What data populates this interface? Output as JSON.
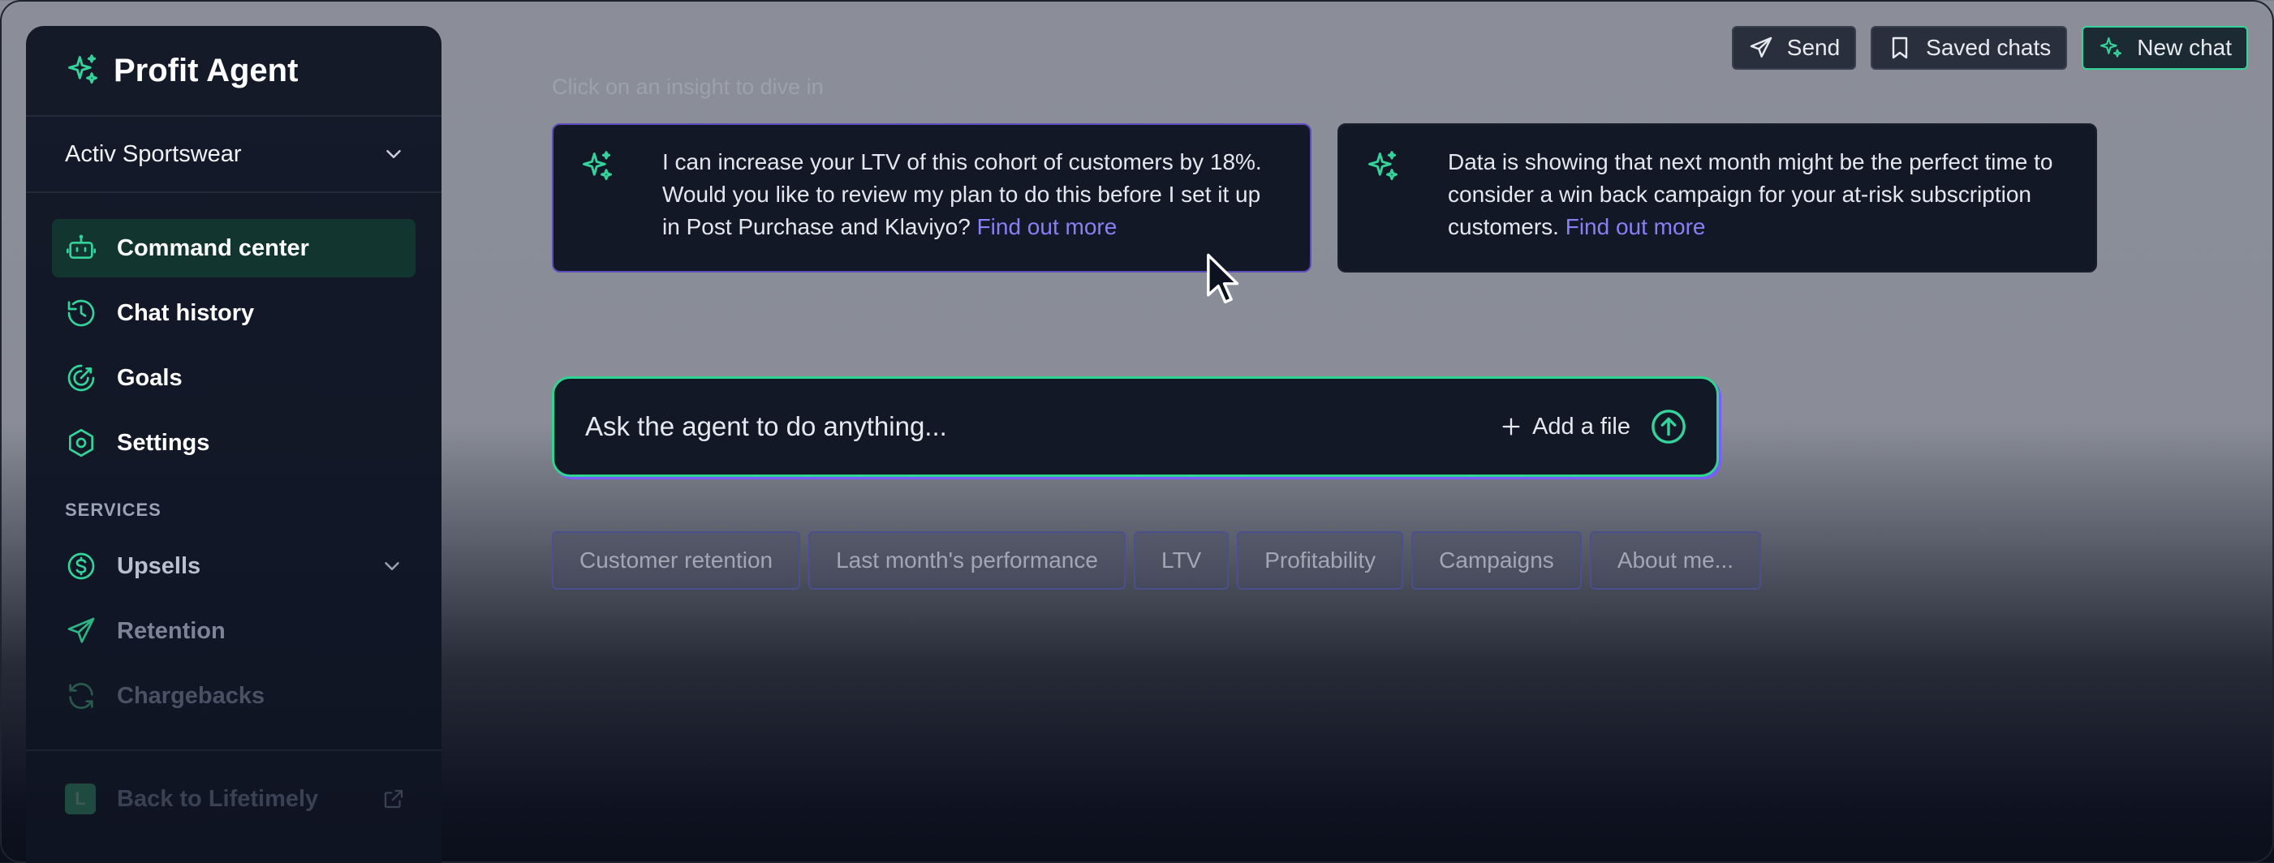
{
  "sidebar": {
    "brand_title": "Profit Agent",
    "store_selector": {
      "value": "Activ Sportswear"
    },
    "nav_items": [
      {
        "label": "Command center",
        "icon": "robot-icon",
        "active": true
      },
      {
        "label": "Chat history",
        "icon": "history-icon"
      },
      {
        "label": "Goals",
        "icon": "target-icon"
      },
      {
        "label": "Settings",
        "icon": "hexagon-settings-icon"
      }
    ],
    "services_title": "SERVICES",
    "services": [
      {
        "label": "Upsells",
        "icon": "dollar-circle-icon"
      },
      {
        "label": "Retention",
        "icon": "paper-plane-icon"
      },
      {
        "label": "Chargebacks",
        "icon": "refresh-icon"
      }
    ],
    "back_link": {
      "label": "Back to Lifetimely",
      "badge": "L"
    }
  },
  "top_actions": {
    "send": "Send",
    "saved_chats": "Saved chats",
    "new_chat": "New chat"
  },
  "main": {
    "hint": "Click on an insight to dive in",
    "insights": [
      {
        "text": "I can increase your LTV of this cohort of customers by 18%. Would you like to review my plan to do this before I set it up in Post Purchase and Klaviyo?",
        "link": "Find out more"
      },
      {
        "text": "Data is showing that next month might be the perfect time to consider a win back campaign for your at-risk subscription customers.",
        "link": "Find out more"
      }
    ],
    "ask": {
      "placeholder": "Ask the agent to do anything...",
      "add_file": "Add a file"
    },
    "chips": [
      "Customer retention",
      "Last month's performance",
      "LTV",
      "Profitability",
      "Campaigns",
      "About me..."
    ]
  },
  "colors": {
    "accent_green": "#34d399",
    "accent_purple": "#8b7ff6",
    "panel": "#121826"
  }
}
